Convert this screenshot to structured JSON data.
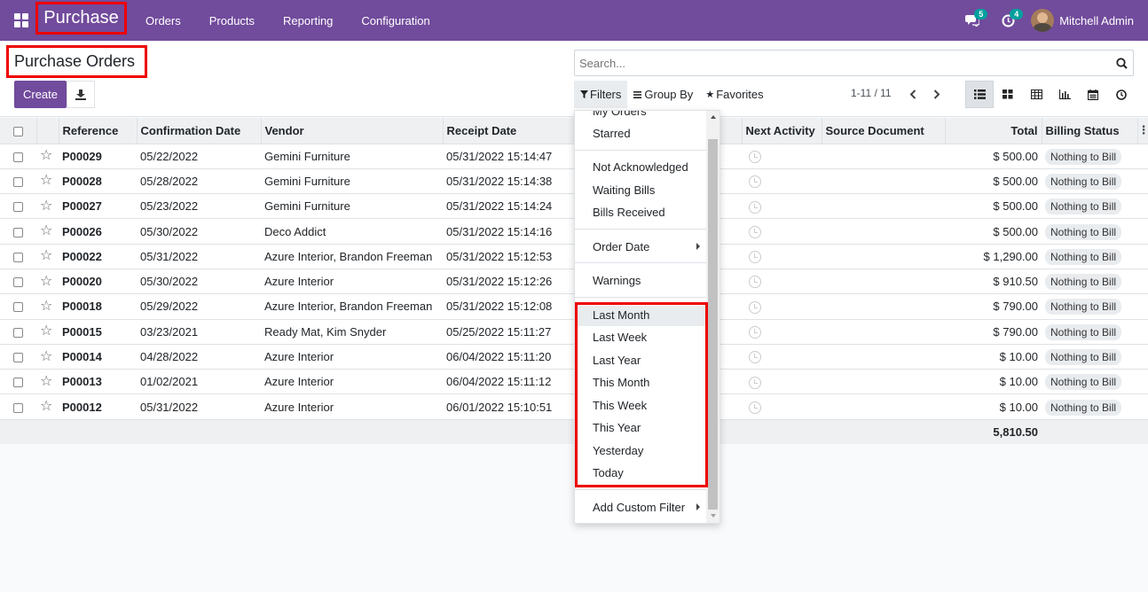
{
  "navbar": {
    "app_name": "Purchase",
    "menu": [
      "Orders",
      "Products",
      "Reporting",
      "Configuration"
    ],
    "messages_count": "5",
    "activities_count": "4",
    "user_name": "Mitchell Admin"
  },
  "control_panel": {
    "title": "Purchase Orders",
    "create_label": "Create",
    "search_placeholder": "Search...",
    "filters_label": "Filters",
    "group_by_label": "Group By",
    "favorites_label": "Favorites",
    "pager": "1-11 / 11"
  },
  "table": {
    "columns": [
      "Reference",
      "Confirmation Date",
      "Vendor",
      "Receipt Date",
      "Next Activity",
      "Source Document",
      "Total",
      "Billing Status"
    ],
    "rows": [
      {
        "ref": "P00029",
        "confirm": "05/22/2022",
        "vendor": "Gemini Furniture",
        "receipt": "05/31/2022 15:14:47",
        "total": "$ 500.00",
        "billing": "Nothing to Bill"
      },
      {
        "ref": "P00028",
        "confirm": "05/28/2022",
        "vendor": "Gemini Furniture",
        "receipt": "05/31/2022 15:14:38",
        "total": "$ 500.00",
        "billing": "Nothing to Bill"
      },
      {
        "ref": "P00027",
        "confirm": "05/23/2022",
        "vendor": "Gemini Furniture",
        "receipt": "05/31/2022 15:14:24",
        "total": "$ 500.00",
        "billing": "Nothing to Bill"
      },
      {
        "ref": "P00026",
        "confirm": "05/30/2022",
        "vendor": "Deco Addict",
        "receipt": "05/31/2022 15:14:16",
        "total": "$ 500.00",
        "billing": "Nothing to Bill"
      },
      {
        "ref": "P00022",
        "confirm": "05/31/2022",
        "vendor": "Azure Interior, Brandon Freeman",
        "receipt": "05/31/2022 15:12:53",
        "total": "$ 1,290.00",
        "billing": "Nothing to Bill"
      },
      {
        "ref": "P00020",
        "confirm": "05/30/2022",
        "vendor": "Azure Interior",
        "receipt": "05/31/2022 15:12:26",
        "total": "$ 910.50",
        "billing": "Nothing to Bill"
      },
      {
        "ref": "P00018",
        "confirm": "05/29/2022",
        "vendor": "Azure Interior, Brandon Freeman",
        "receipt": "05/31/2022 15:12:08",
        "total": "$ 790.00",
        "billing": "Nothing to Bill"
      },
      {
        "ref": "P00015",
        "confirm": "03/23/2021",
        "vendor": "Ready Mat, Kim Snyder",
        "receipt": "05/25/2022 15:11:27",
        "total": "$ 790.00",
        "billing": "Nothing to Bill"
      },
      {
        "ref": "P00014",
        "confirm": "04/28/2022",
        "vendor": "Azure Interior",
        "receipt": "06/04/2022 15:11:20",
        "total": "$ 10.00",
        "billing": "Nothing to Bill"
      },
      {
        "ref": "P00013",
        "confirm": "01/02/2021",
        "vendor": "Azure Interior",
        "receipt": "06/04/2022 15:11:12",
        "total": "$ 10.00",
        "billing": "Nothing to Bill"
      },
      {
        "ref": "P00012",
        "confirm": "05/31/2022",
        "vendor": "Azure Interior",
        "receipt": "06/01/2022 15:10:51",
        "total": "$ 10.00",
        "billing": "Nothing to Bill"
      }
    ],
    "grand_total": "5,810.50"
  },
  "filters_dropdown": {
    "items": [
      "My Orders",
      "Starred",
      "Not Acknowledged",
      "Waiting Bills",
      "Bills Received",
      "Order Date",
      "Warnings",
      "Last Month",
      "Last Week",
      "Last Year",
      "This Month",
      "This Week",
      "This Year",
      "Yesterday",
      "Today",
      "Add Custom Filter"
    ]
  }
}
